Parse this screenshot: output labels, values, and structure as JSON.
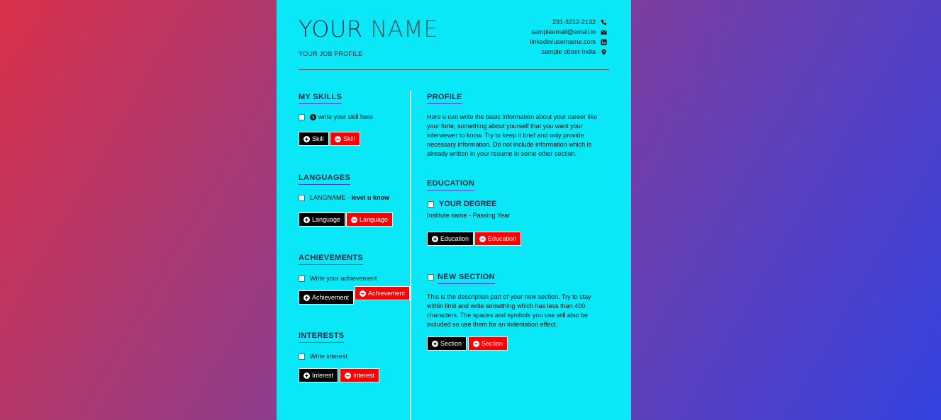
{
  "header": {
    "first_name": "YOUR",
    "last_name": "NAME",
    "job_profile": "YOUR JOB PROFILE",
    "contacts": [
      {
        "text": "231-3212-2132",
        "icon": "phone-icon"
      },
      {
        "text": "sampleemail@email.in",
        "icon": "envelope-icon"
      },
      {
        "text": "linkedin/username.com",
        "icon": "linkedin-icon"
      },
      {
        "text": "sample street-India",
        "icon": "map-marker-icon"
      }
    ]
  },
  "left": {
    "skills": {
      "heading": "MY SKILLS",
      "item": "write your skill here",
      "add": "Skill",
      "remove": "Skill"
    },
    "languages": {
      "heading": "LANGUAGES",
      "item_name": "LANGNAME -",
      "item_level": "level u know",
      "add": "Language",
      "remove": "Language"
    },
    "achievements": {
      "heading": "ACHIEVEMENTS",
      "item": "Write your achievement",
      "add": "Achievement",
      "remove": "Achievement"
    },
    "interests": {
      "heading": "INTERESTS",
      "item": "Write interest",
      "add": "Interest",
      "remove": "Interest"
    }
  },
  "right": {
    "profile": {
      "heading": "PROFILE",
      "lines": [
        "Here u can write the basic information about your career like",
        "your forte, something about yourself that you want your",
        "interviewer to know. Try to keep it brief and only provide",
        "necessary information. Do not include information which is",
        "already written in your resume in some other section."
      ]
    },
    "education": {
      "heading": "EDUCATION",
      "degree": "YOUR DEGREE",
      "institute": "Institute name - Passing Year",
      "add": "Education",
      "remove": "Education"
    },
    "new_section": {
      "heading": "NEW SECTION",
      "lines": [
        "This is the description part of your new section. Try to stay",
        "within limit and write something which has less than 400",
        "characters. The spaces and symbols you use will also be",
        "included so use them for an indentation effect."
      ],
      "add": "Section",
      "remove": "Section"
    }
  },
  "colors": {
    "page": "#0ae8f7",
    "add_button": "#000000",
    "remove_button": "#ff0000",
    "heading_underline": "#5a3fcf"
  }
}
